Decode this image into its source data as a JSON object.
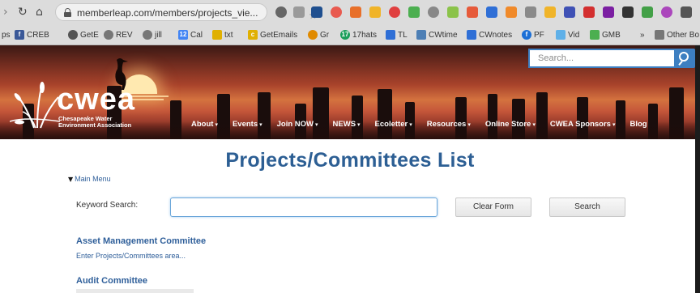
{
  "browser": {
    "url": "memberleap.com/members/projects_vie...",
    "bookmarks": [
      {
        "label": "ps",
        "color": ""
      },
      {
        "label": "CREB",
        "color": "#3b5998"
      },
      {
        "label": "GetE",
        "color": "#555555"
      },
      {
        "label": "REV",
        "color": "#777777"
      },
      {
        "label": "jill",
        "color": "#777777"
      },
      {
        "label": "Cal",
        "color": "#4285f4"
      },
      {
        "label": "txt",
        "color": "#e0b000"
      },
      {
        "label": "GetEmails",
        "color": "#e0b000"
      },
      {
        "label": "Gr",
        "color": "#e08a00"
      },
      {
        "label": "17hats",
        "color": "#1b9e5a"
      },
      {
        "label": "TL",
        "color": "#2f6fd6"
      },
      {
        "label": "CWtime",
        "color": "#4d7fb5"
      },
      {
        "label": "CWnotes",
        "color": "#2f6fd6"
      },
      {
        "label": "PF",
        "color": "#1b6fd6"
      },
      {
        "label": "Vid",
        "color": "#5fb0e8"
      },
      {
        "label": "GMB",
        "color": "#4caf50"
      },
      {
        "label": "»",
        "color": ""
      },
      {
        "label": "Other Bo",
        "color": "#777777"
      }
    ]
  },
  "site": {
    "search_placeholder": "Search...",
    "logo_word": "cwea",
    "logo_sub_1": "Chesapeake Water",
    "logo_sub_2": "Environment Association",
    "nav": [
      {
        "label": "About",
        "dropdown": true
      },
      {
        "label": "Events",
        "dropdown": true
      },
      {
        "label": "Join NOW",
        "dropdown": true
      },
      {
        "label": "NEWS",
        "dropdown": true
      },
      {
        "label": "Ecoletter",
        "dropdown": true
      },
      {
        "label": "Resources",
        "dropdown": true
      },
      {
        "label": "Online Store",
        "dropdown": true
      },
      {
        "label": "CWEA Sponsors",
        "dropdown": true
      },
      {
        "label": "Blog",
        "dropdown": false
      }
    ],
    "caret_glyph": "▾"
  },
  "content": {
    "page_title": "Projects/Committees List",
    "main_menu_label": "Main Menu",
    "keyword_label": "Keyword Search:",
    "keyword_value": "",
    "clear_button": "Clear Form",
    "search_button": "Search",
    "committees": [
      {
        "name": "Asset Management Committee",
        "link": "Enter Projects/Committees area..."
      },
      {
        "name": "Audit Committee",
        "link": ""
      }
    ]
  }
}
